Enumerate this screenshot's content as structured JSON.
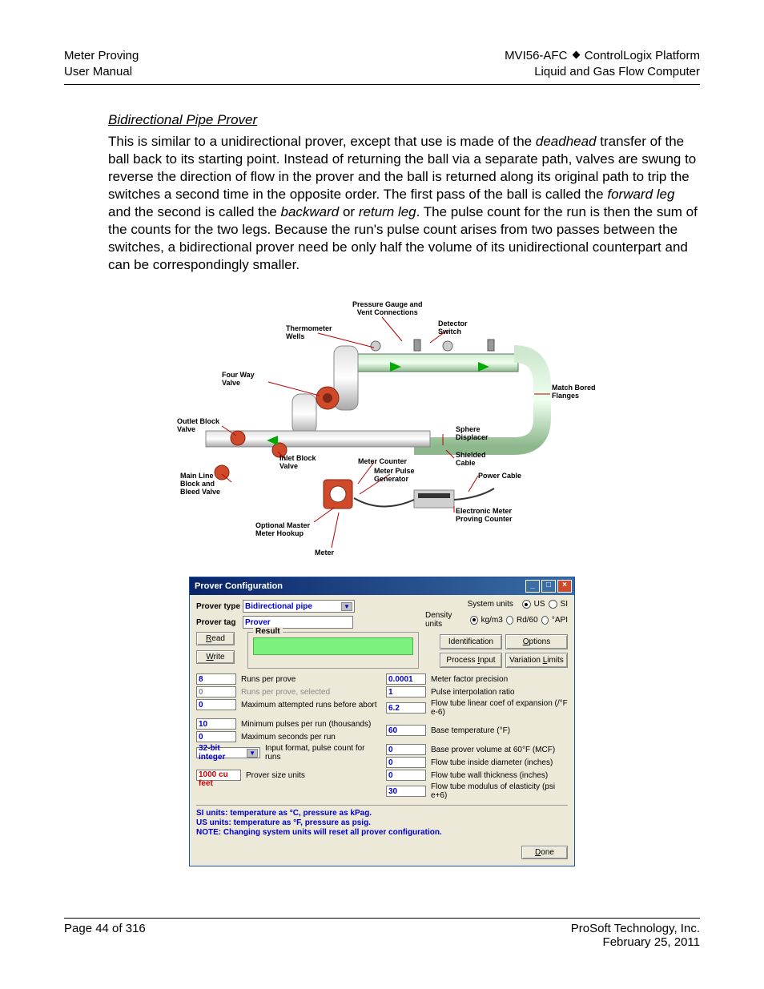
{
  "header": {
    "left1": "Meter Proving",
    "left2": "User Manual",
    "right1a": "MVI56-AFC",
    "right1b": "ControlLogix Platform",
    "right2": "Liquid and Gas Flow Computer"
  },
  "section": {
    "title": "Bidirectional Pipe Prover",
    "p_a": "This is similar to a unidirectional prover, except that use is made of the ",
    "p_b": "deadhead",
    "p_c": " transfer of the ball back to its starting point. Instead of returning the ball via a separate path, valves are swung to reverse the direction of flow in the prover and the ball is returned along its original path to trip the switches a second time in the opposite order. The first pass of the ball is called the ",
    "p_d": "forward leg",
    "p_e": " and the second is called the ",
    "p_f": "backward",
    "p_g": " or ",
    "p_h": "return leg",
    "p_i": ". The pulse count for the run is then the sum of the counts for the two legs. Because the run's pulse count arises from two passes between the switches, a bidirectional prover need be only half the volume of its unidirectional counterpart and can be correspondingly smaller."
  },
  "diagram": {
    "pressure": "Pressure Gauge and\nVent Connections",
    "thermo": "Thermometer\nWells",
    "detector": "Detector\nSwitch",
    "fourway": "Four Way\nValve",
    "match": "Match Bored\nFlanges",
    "outlet": "Outlet Block\nValve",
    "inlet": "Inlet Block\nValve",
    "sphere": "Sphere\nDisplacer",
    "shielded": "Shielded\nCable",
    "metercounter": "Meter Counter",
    "meterpulse": "Meter Pulse\nGenerator",
    "power": "Power Cable",
    "mainline": "Main Line\nBlock and\nBleed Valve",
    "optional": "Optional Master\nMeter Hookup",
    "electronic": "Electronic Meter\nProving Counter",
    "meter": "Meter"
  },
  "dialog": {
    "title": "Prover Configuration",
    "labels": {
      "type": "Prover type",
      "tag": "Prover tag",
      "sysunits": "System units",
      "densunits": "Density units"
    },
    "values": {
      "type": "Bidirectional pipe",
      "tag": "Prover"
    },
    "radios": {
      "us": "US",
      "si": "SI",
      "kgm3": "kg/m3",
      "rd60": "Rd/60",
      "api": "°API"
    },
    "buttons": {
      "read": "Read",
      "write": "Write",
      "ident": "Identification",
      "options": "Options",
      "procin": "Process Input",
      "varlim": "Variation Limits",
      "done": "Done"
    },
    "result_legend": "Result",
    "left": [
      {
        "val": "8",
        "label": "Runs per prove",
        "cls": ""
      },
      {
        "val": "0",
        "label": "Runs per prove, selected",
        "cls": "gray"
      },
      {
        "val": "0",
        "label": "Maximum attempted runs before abort",
        "cls": ""
      },
      {
        "val": "10",
        "label": "Minimum pulses per run (thousands)",
        "cls": ""
      },
      {
        "val": "0",
        "label": "Maximum seconds per run",
        "cls": ""
      },
      {
        "val": "32-bit integer",
        "label": "Input format, pulse count for runs",
        "cls": "sel"
      },
      {
        "val": "1000 cu feet",
        "label": "Prover size units",
        "cls": "red"
      }
    ],
    "right": [
      {
        "val": "0.0001",
        "label": "Meter factor precision"
      },
      {
        "val": "1",
        "label": "Pulse interpolation ratio"
      },
      {
        "val": "6.2",
        "label": "Flow tube linear coef of expansion (/°F e-6)"
      },
      {
        "val": "60",
        "label": "Base temperature (°F)"
      },
      {
        "val": "0",
        "label": "Base prover volume at 60°F (MCF)"
      },
      {
        "val": "0",
        "label": "Flow tube inside diameter (inches)"
      },
      {
        "val": "0",
        "label": "Flow tube wall thickness (inches)"
      },
      {
        "val": "30",
        "label": "Flow tube modulus of elasticity (psi e+6)"
      }
    ],
    "note1": "SI units: temperature as °C, pressure as kPag.",
    "note2": "US units: temperature as °F, pressure as psig.",
    "note3": "NOTE: Changing system units will reset all prover configuration."
  },
  "footer": {
    "page": "Page 44 of 316",
    "company": "ProSoft Technology, Inc.",
    "date": "February 25, 2011"
  }
}
